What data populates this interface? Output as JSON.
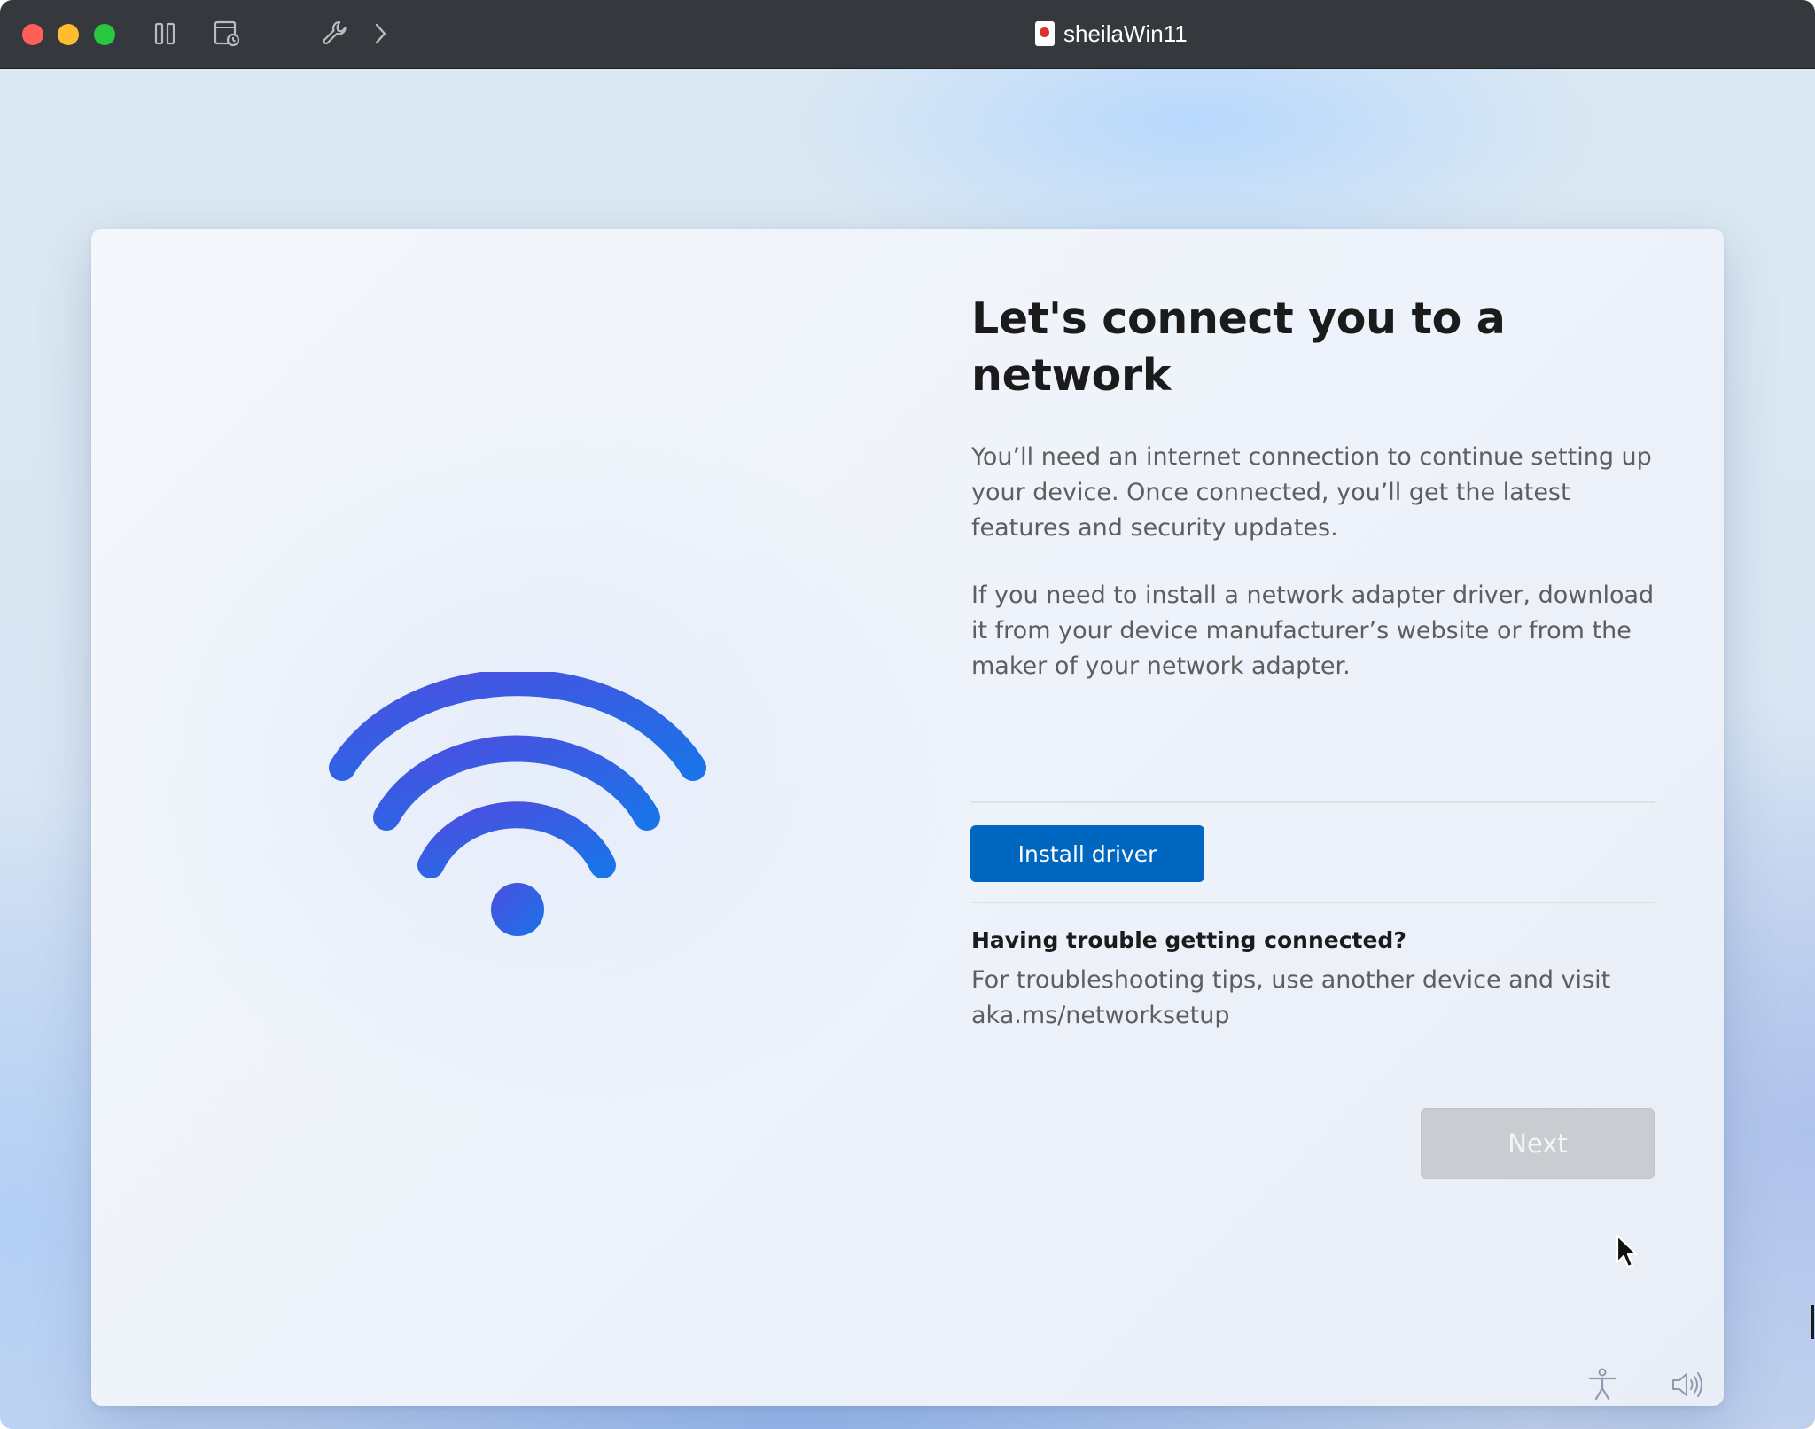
{
  "window": {
    "title": "sheilaWin11"
  },
  "page": {
    "title": "Let's connect you to a network",
    "paragraph1": "You’ll need an internet connection to continue setting up your device. Once connected, you’ll get the latest features and security updates.",
    "paragraph2": "If you need to install a network adapter driver, download it from your device manufacturer’s website or from the maker of your network adapter.",
    "install_button": "Install driver",
    "trouble_heading": "Having trouble getting connected?",
    "trouble_text": "For troubleshooting tips, use another device and visit aka.ms/networksetup",
    "next_button": "Next"
  },
  "toolbar": {
    "icons": [
      "pause-icon",
      "snapshot-icon",
      "wrench-icon",
      "chevron-right-icon"
    ]
  },
  "taskbar": {
    "icons": [
      "accessibility-icon",
      "volume-icon"
    ]
  },
  "colors": {
    "accent": "#0067c0",
    "wifi_gradient_start": "#4b4fe0",
    "wifi_gradient_end": "#1a73e8",
    "titlebar": "#35383c",
    "next_disabled": "#c9ccd1"
  }
}
